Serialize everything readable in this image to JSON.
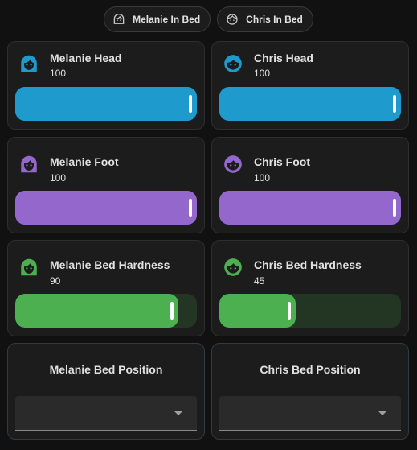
{
  "chips": [
    {
      "label": "Melanie In Bed",
      "icon": "face-woman-outline-icon"
    },
    {
      "label": "Chris In Bed",
      "icon": "face-man-outline-icon"
    }
  ],
  "cards": [
    {
      "name": "Melanie Head",
      "state": "100",
      "icon": "face-woman-icon",
      "color": "#1e9bcc",
      "track": "#1e9bcc",
      "level": 1.0
    },
    {
      "name": "Chris Head",
      "state": "100",
      "icon": "face-man-icon",
      "color": "#1e9bcc",
      "track": "#1e9bcc",
      "level": 1.0
    },
    {
      "name": "Melanie Foot",
      "state": "100",
      "icon": "face-woman-icon",
      "color": "#9467cc",
      "track": "#9467cc",
      "level": 1.0
    },
    {
      "name": "Chris Foot",
      "state": "100",
      "icon": "face-man-icon",
      "color": "#9467cc",
      "track": "#9467cc",
      "level": 1.0
    },
    {
      "name": "Melanie Bed Hardness",
      "state": "90",
      "icon": "face-woman-icon",
      "color": "#4caf50",
      "track": "#233523",
      "level": 0.9
    },
    {
      "name": "Chris Bed Hardness",
      "state": "45",
      "icon": "face-man-icon",
      "color": "#4caf50",
      "track": "#233523",
      "level": 0.42
    }
  ],
  "selects": [
    {
      "title": "Melanie Bed Position",
      "value": ""
    },
    {
      "title": "Chris Bed Position",
      "value": ""
    }
  ]
}
